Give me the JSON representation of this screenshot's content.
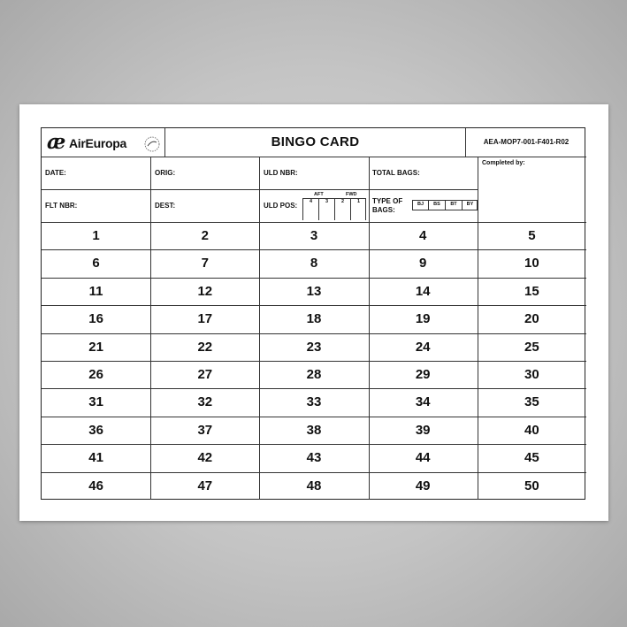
{
  "brand": {
    "mark": "æ",
    "name": "AirEuropa",
    "alliance": "SKYTEAM"
  },
  "header": {
    "title": "BINGO CARD",
    "form_code": "AEA-MOP7-001-F401-R02"
  },
  "fields": {
    "date": "DATE:",
    "orig": "ORIG:",
    "uld_nbr": "ULD NBR:",
    "total_bags": "TOTAL BAGS:",
    "completed_by": "Completed by:",
    "flt_nbr": "FLT NBR:",
    "dest": "DEST:",
    "uld_pos": "ULD POS:",
    "aft": "AFT",
    "fwd": "FWD",
    "positions": [
      "4",
      "3",
      "2",
      "1"
    ],
    "type_of_bags_line1": "TYPE OF",
    "type_of_bags_line2": "BAGS:",
    "bag_types": [
      "BJ",
      "BS",
      "BT",
      "BY"
    ]
  },
  "grid": {
    "numbers": [
      [
        "1",
        "2",
        "3",
        "4",
        "5"
      ],
      [
        "6",
        "7",
        "8",
        "9",
        "10"
      ],
      [
        "11",
        "12",
        "13",
        "14",
        "15"
      ],
      [
        "16",
        "17",
        "18",
        "19",
        "20"
      ],
      [
        "21",
        "22",
        "23",
        "24",
        "25"
      ],
      [
        "26",
        "27",
        "28",
        "29",
        "30"
      ],
      [
        "31",
        "32",
        "33",
        "34",
        "35"
      ],
      [
        "36",
        "37",
        "38",
        "39",
        "40"
      ],
      [
        "41",
        "42",
        "43",
        "44",
        "45"
      ],
      [
        "46",
        "47",
        "48",
        "49",
        "50"
      ]
    ]
  }
}
